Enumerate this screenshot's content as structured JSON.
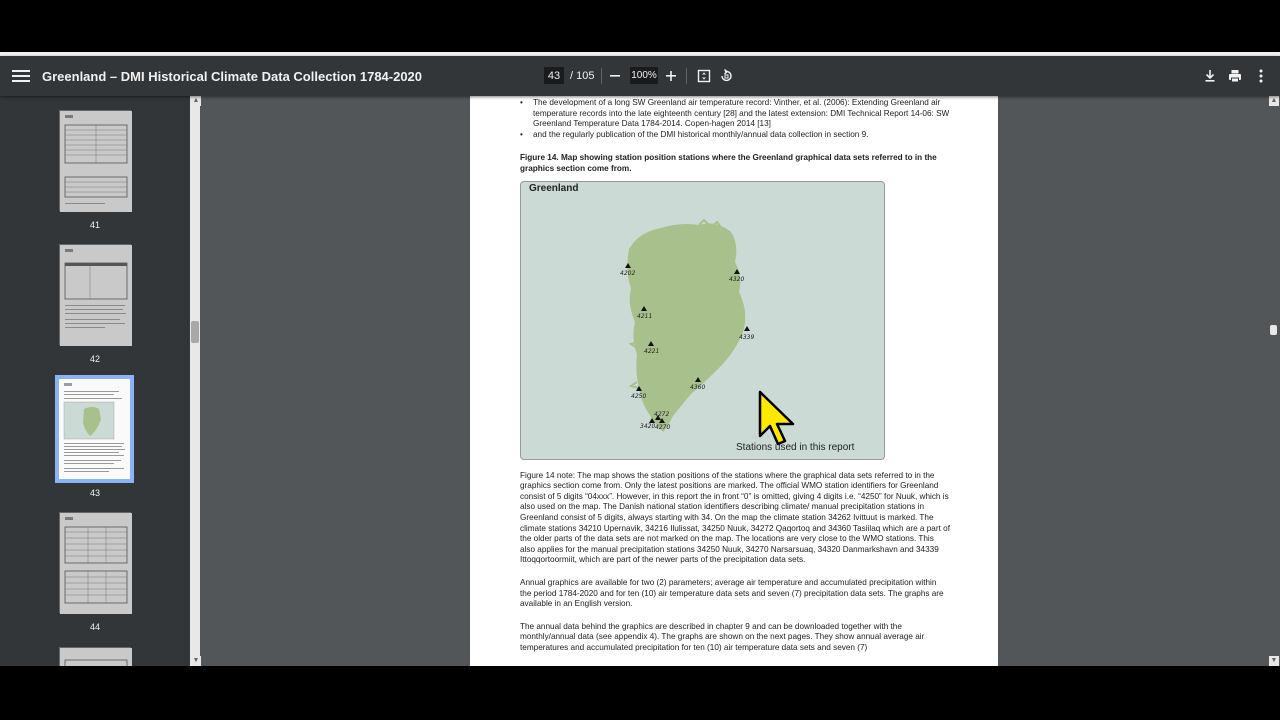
{
  "toolbar": {
    "title": "Greenland – DMI Historical Climate Data Collection 1784-2020",
    "current_page": "43",
    "total_pages": "/ 105",
    "zoom": "100%"
  },
  "thumbnails": [
    {
      "label": "41"
    },
    {
      "label": "42"
    },
    {
      "label": "43",
      "active": true
    },
    {
      "label": "44"
    }
  ],
  "document": {
    "bullets": [
      "The development of a long SW Greenland air temperature record: Vinther, et al. (2006): Extending Greenland air temperature records into the late eighteenth century [28] and the latest extension: DMI Technical Report 14-06: SW Greenland Temperature Data 1784-2014. Copen-hagen 2014 [13]",
      "and the regularly publication of the DMI historical monthly/annual data collection in section 9."
    ],
    "figure_caption": "Figure 14. Map showing station position stations where the Greenland graphical data sets referred to in the graphics section come from.",
    "map": {
      "title": "Greenland",
      "legend": "Stations used in this report",
      "land_color": "#a8c08c",
      "sea_color": "#ccdad5",
      "stations": [
        "4202",
        "4320",
        "4211",
        "4339",
        "4221",
        "4360",
        "4250",
        "4272",
        "3420",
        "4270"
      ]
    },
    "paragraphs": [
      "Figure 14 note: The map shows the station positions of the stations where the graphical data sets referred to in the graphics section come from. Only the latest positions are marked. The official WMO station identifiers for Greenland consist of 5 digits “04xxx”. However, in this report the in front “0” is omitted, giving 4 digits i.e. “4250” for Nuuk, which is also used on the map. The Danish national station identifiers describing climate/ manual precipitation stations in Greenland consist of 5 digits, always starting with 34. On the map the climate station 34262 Ivittuut is marked. The climate stations 34210 Upernavik, 34216 Ilulissat, 34250 Nuuk, 34272 Qaqortoq and 34360 Tasiilaq which are a part of the older parts of the data sets are not marked on the map. The locations are very close to the WMO stations. This also applies for the manual precipitation stations 34250 Nuuk, 34270 Narsarsuaq, 34320 Danmarkshavn and 34339 Ittoqqortoormiit, which are part of the newer parts of the precipitation data sets.",
      "Annual graphics are available for two (2) parameters; average air temperature and accumulated precipitation within the period 1784-2020 and for ten (10) air temperature data sets and seven (7) precipitation data sets. The graphs are available in an English version.",
      "The annual data behind the graphics are described in chapter 9 and can be downloaded together with the monthly/annual data (see appendix 4). The graphs are shown on the next pages. They show annual average air temperatures and accumulated precipitation for ten (10) air temperature data sets and seven (7)"
    ]
  }
}
